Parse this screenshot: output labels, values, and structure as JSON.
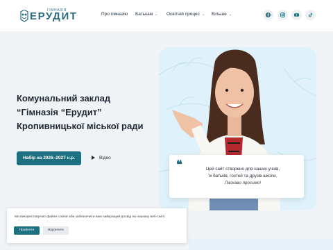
{
  "logo": {
    "small": "ГІМНАЗІЯ",
    "big": "ЕРУДИТ"
  },
  "nav": [
    {
      "label": "Про гімназію",
      "has_dropdown": false
    },
    {
      "label": "Батькам",
      "has_dropdown": true
    },
    {
      "label": "Освітній процес",
      "has_dropdown": true
    },
    {
      "label": "Більше",
      "has_dropdown": true
    }
  ],
  "social": [
    "facebook-icon",
    "instagram-icon",
    "youtube-icon",
    "tiktok-icon"
  ],
  "hero": {
    "title_lines": [
      "Комунальний заклад",
      "“Гімназія “Ерудит”",
      "Кропивницької міської ради"
    ],
    "cta": "Набір на 2026–2027 н.р.",
    "video": "Відео"
  },
  "quote": {
    "line1": "Цей сайт створено для наших учнів,",
    "line2": "їх батьків, гостей та друзів школи.",
    "line3": "Ласкаво просимо!"
  },
  "cookie": {
    "text": "Ми використовуємо файли cookie аби забезпечити вам найкращий досвід на нашому веб-сайті.",
    "accept": "Прийняти",
    "reject": "Відхилити"
  },
  "colors": {
    "accent": "#1e6f80",
    "hero_card": "#dff1fa",
    "background": "#f1f4f7"
  }
}
